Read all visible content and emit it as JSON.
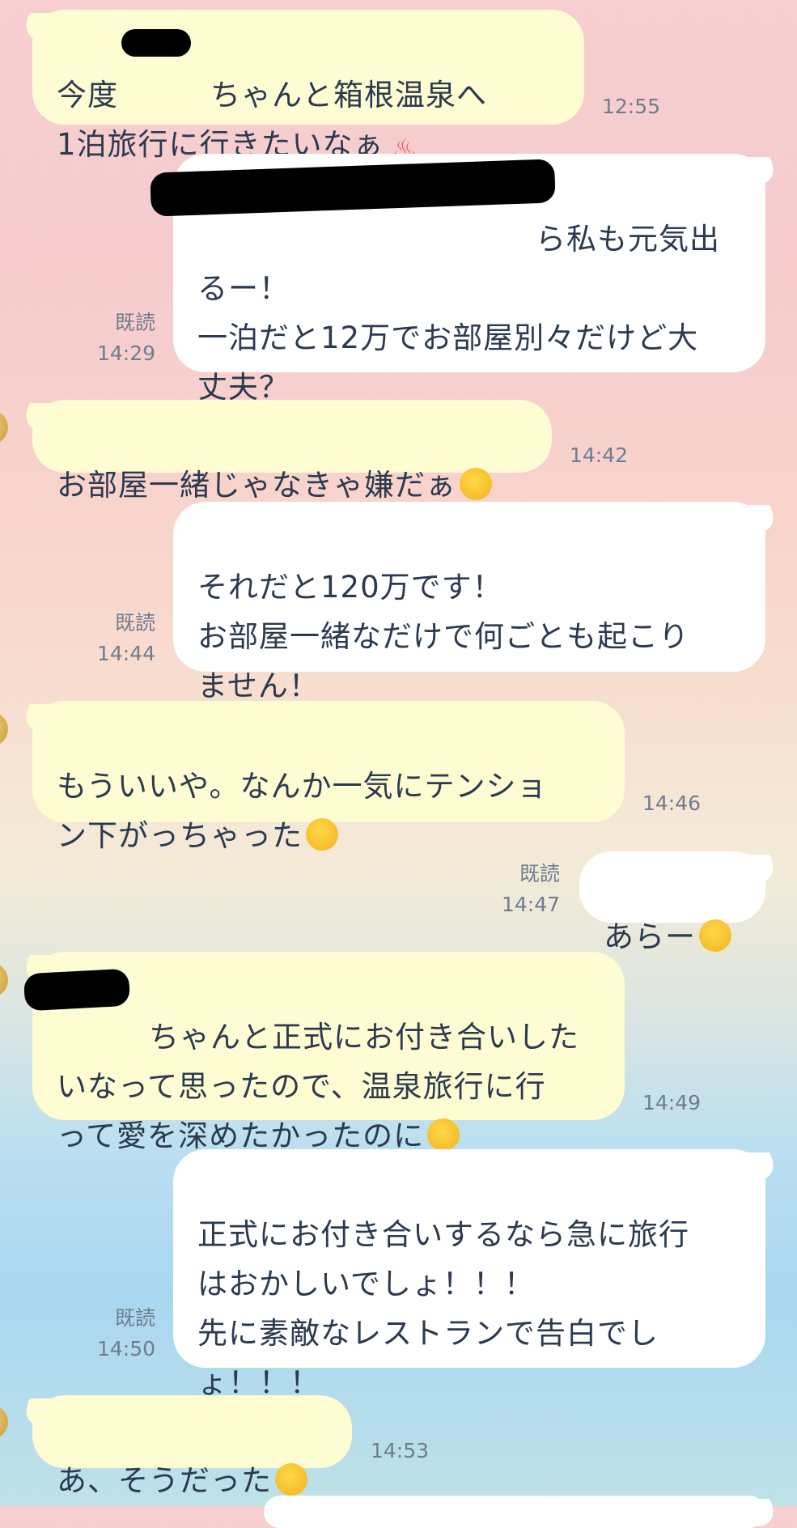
{
  "messages": [
    {
      "id": "m1",
      "side": "in",
      "text": "今度　　　ちゃんと箱根温泉へ\n1泊旅行に行きたいなぁ",
      "emoji": "hot-springs",
      "time": "12:55"
    },
    {
      "id": "m2",
      "side": "out",
      "text": "　　　　　　　　　　　ら私も元気出\nるー！\n一泊だと12万でお部屋別々だけど大\n丈夫？",
      "read": "既読",
      "time": "14:29"
    },
    {
      "id": "m3",
      "side": "in",
      "text": "お部屋一緒じゃなきゃ嫌だぁ",
      "emoji": "loudly-crying-face",
      "time": "14:42"
    },
    {
      "id": "m4",
      "side": "out",
      "text": "それだと120万です！\nお部屋一緒なだけで何ごとも起こり\nません！",
      "read": "既読",
      "time": "14:44"
    },
    {
      "id": "m5",
      "side": "in",
      "text": "もういいや。なんか一気にテンショ\nン下がっちゃった",
      "emoji": "pensive-face",
      "time": "14:46"
    },
    {
      "id": "m6",
      "side": "out",
      "text": "あらー",
      "emoji": "pleading-face",
      "read": "既読",
      "time": "14:47"
    },
    {
      "id": "m7",
      "side": "in",
      "text": "　　　ちゃんと正式にお付き合いした\nいなって思ったので、温泉旅行に行\nって愛を深めたかったのに",
      "emoji": "crying-face",
      "time": "14:49"
    },
    {
      "id": "m8",
      "side": "out",
      "text": "正式にお付き合いするなら急に旅行\nはおかしいでしょ！！！\n先に素敵なレストランで告白でし\nょ！！！",
      "read": "既読",
      "time": "14:50"
    },
    {
      "id": "m9",
      "side": "in",
      "text": "あ、そうだった",
      "emoji": "face-with-tongue",
      "time": "14:53"
    }
  ],
  "colors": {
    "incoming_bubble": "#fefcd2",
    "outgoing_bubble": "#ffffff",
    "text": "#2c3a4f",
    "meta_text": "#6f7d8f"
  }
}
